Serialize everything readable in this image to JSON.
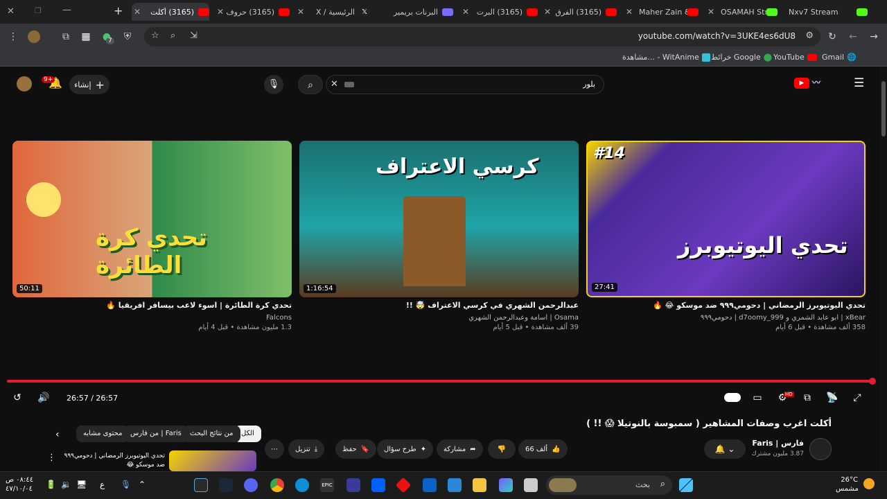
{
  "tabs": [
    {
      "label": "Nxv7 Stream",
      "icon_color": "#53fc18"
    },
    {
      "label": "OSAMAH Stre",
      "icon_color": "#53fc18"
    },
    {
      "label": "Maher Zain &",
      "icon_color": "#ff0000"
    },
    {
      "label": "(3165) الفرق",
      "icon_color": "#ff0000"
    },
    {
      "label": "(3165) البرت",
      "icon_color": "#ff0000"
    },
    {
      "label": "البرنات بريمير",
      "icon_color": "#7a6cff"
    },
    {
      "label": "الرئيسية / X",
      "icon_color": "#ffffff"
    },
    {
      "label": "(3165) حروف",
      "icon_color": "#ff0000"
    },
    {
      "label": "(3165) أكلت",
      "icon_color": "#ff0000"
    }
  ],
  "toolbar": {
    "url": "youtube.com/watch?v=3UKE4es6dU8",
    "extension_badge": "7"
  },
  "bookmarks": [
    "Gmail",
    "YouTube",
    "خرائط Google",
    "مشاهدة... - WitAnime"
  ],
  "youtube": {
    "search_value": "بلور",
    "create_label": "إنشاء",
    "notif_badge": "9+"
  },
  "videos": [
    {
      "title": "تحدي اليوتيوبرز الرمضاني | دحومي٩٩٩ ضد موسكو 😂 🔥",
      "channel": "xBear | ابو عابد الشمري و d7oomy_999 | دحومي٩٩٩",
      "meta": "358 ألف مشاهدة • قبل 6 أيام",
      "duration": "27:41",
      "overlay_text": "تحدي اليوتيوبرز",
      "badge": "#14"
    },
    {
      "title": "عبدالرحمن الشهري في كرسي الاعتراف 🤯 !!",
      "channel": "Osama | اسامة وعبدالرحمن الشهري",
      "meta": "39 ألف مشاهدة • قبل 5 أيام",
      "duration": "1:16:54",
      "overlay_text": "كرسي الاعتراف"
    },
    {
      "title": "تحدي كرة الطائرة | اسوء لاعب بيسافر افريقيا 🔥",
      "channel": "Falcons",
      "meta": "1.3 مليون مشاهدة • قبل 4 أيام",
      "duration": "50:11",
      "overlay_text": "تحدي كرة الطائرة"
    }
  ],
  "player": {
    "time": "26:57 / 26:57",
    "progress_fraction": 1.0,
    "hd_badge": "HD"
  },
  "watch": {
    "title": "أكلت اغرب وصفات المشاهير ( سمبوسة بالنوتيلا 😱 !! )",
    "channel_name": "فارس | Faris",
    "subscribers": "3.87 مليون مشترك",
    "likes": "66 ألف",
    "share_label": "مشاركة",
    "ask_label": "طرح سؤال",
    "save_label": "حفظ",
    "download_label": "تنزيل"
  },
  "chips": [
    "الكل",
    "من نتائج البحث",
    "من فارس | Faris",
    "محتوى مشابه"
  ],
  "up_next": {
    "title": "تحدي اليوتيوبرز الرمضاني | دحومي٩٩٩ ضد موسكو 😂"
  },
  "taskbar": {
    "weather_temp": "26°C",
    "weather_label": "مشمس",
    "search_placeholder": "بحث",
    "time": "٠٨:٤٤ ص",
    "date": "٤٧/١٠/٠٤",
    "lang": "ع"
  }
}
